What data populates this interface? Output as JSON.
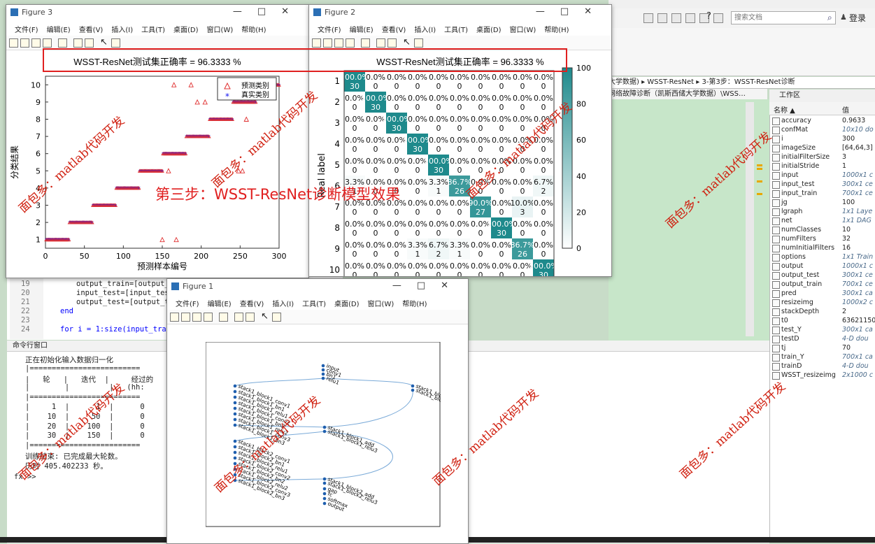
{
  "desktop": {
    "search_placeholder": "搜索文档",
    "login_label": "登录",
    "path_segments": "大学数据) ▸ WSST-ResNet ▸ 3-第3步：WSST-ResNet诊断",
    "path_sub": "网络故障诊断（凯斯西储大学数据）\\WSS…"
  },
  "editor": {
    "line_numbers": [
      "19",
      "20",
      "21",
      "22",
      "23",
      "24"
    ],
    "lines": [
      "output_train=[output_tr",
      "input_test=[input_test;",
      "output_test=[output_tes",
      "end",
      "",
      "for i = 1:size(input_train,"
    ]
  },
  "command_window": {
    "title": "命令行窗口",
    "lines": [
      "正在初始化输入数据归一化",
      "|=========================",
      "|   轮   |   迭代  |     经过的",
      "|        |         |   (hh:",
      "|=========================",
      "|     1  |      1  |      0",
      "|    10  |     50  |      0",
      "|    20  |    100  |      0",
      "|    30  |    150  |      0",
      "|=========================",
      "训练结束: 已完成最大轮数。",
      "历时 405.402233 秒。"
    ],
    "prompt": "fx >>"
  },
  "workspace": {
    "title": "工作区",
    "header_name": "名称 ▲",
    "header_value": "值",
    "vars": [
      {
        "name": "accuracy",
        "value": "0.9633",
        "italic": false
      },
      {
        "name": "confMat",
        "value": "10x10 do",
        "italic": true
      },
      {
        "name": "i",
        "value": "300",
        "italic": false
      },
      {
        "name": "imageSize",
        "value": "[64,64,3]",
        "italic": false
      },
      {
        "name": "initialFilterSize",
        "value": "3",
        "italic": false
      },
      {
        "name": "initialStride",
        "value": "1",
        "italic": false
      },
      {
        "name": "input",
        "value": "1000x1 c",
        "italic": true
      },
      {
        "name": "input_test",
        "value": "300x1 ce",
        "italic": true
      },
      {
        "name": "input_train",
        "value": "700x1 ce",
        "italic": true
      },
      {
        "name": "jg",
        "value": "100",
        "italic": false
      },
      {
        "name": "lgraph",
        "value": "1x1 Laye",
        "italic": true
      },
      {
        "name": "net",
        "value": "1x1 DAG",
        "italic": true
      },
      {
        "name": "numClasses",
        "value": "10",
        "italic": false
      },
      {
        "name": "numFilters",
        "value": "32",
        "italic": false
      },
      {
        "name": "numInitialFilters",
        "value": "16",
        "italic": false
      },
      {
        "name": "options",
        "value": "1x1 Train",
        "italic": true
      },
      {
        "name": "output",
        "value": "1000x1 c",
        "italic": true
      },
      {
        "name": "output_test",
        "value": "300x1 ce",
        "italic": true
      },
      {
        "name": "output_train",
        "value": "700x1 ce",
        "italic": true
      },
      {
        "name": "pred",
        "value": "300x1 ca",
        "italic": true
      },
      {
        "name": "resizeimg",
        "value": "1000x2 c",
        "italic": true
      },
      {
        "name": "stackDepth",
        "value": "2",
        "italic": false
      },
      {
        "name": "t0",
        "value": "63621150",
        "italic": false
      },
      {
        "name": "test_Y",
        "value": "300x1 ca",
        "italic": true
      },
      {
        "name": "testD",
        "value": "4-D dou",
        "italic": true
      },
      {
        "name": "tj",
        "value": "70",
        "italic": false
      },
      {
        "name": "train_Y",
        "value": "700x1 ca",
        "italic": true
      },
      {
        "name": "trainD",
        "value": "4-D dou",
        "italic": true
      },
      {
        "name": "WSST_resizeimg",
        "value": "2x1000 c",
        "italic": true
      }
    ]
  },
  "menus": [
    "文件(F)",
    "编辑(E)",
    "查看(V)",
    "插入(I)",
    "工具(T)",
    "桌面(D)",
    "窗口(W)",
    "帮助(H)"
  ],
  "figure3": {
    "title": "Figure 3",
    "chart_data": {
      "type": "scatter",
      "title": "WSST-ResNet测试集正确率 = 96.3333 %",
      "xlabel": "预测样本编号",
      "ylabel": "分类结果",
      "xlim": [
        0,
        300
      ],
      "ylim": [
        0.5,
        10.5
      ],
      "xticks": [
        "0",
        "50",
        "100",
        "150",
        "200",
        "250",
        "300"
      ],
      "yticks": [
        "1",
        "2",
        "3",
        "4",
        "5",
        "6",
        "7",
        "8",
        "9",
        "10"
      ],
      "legend": [
        "预测类别",
        "真实类别"
      ],
      "legend_position": "top-right",
      "true_segments": [
        {
          "class": 1,
          "from": 1,
          "to": 30
        },
        {
          "class": 2,
          "from": 31,
          "to": 60
        },
        {
          "class": 3,
          "from": 61,
          "to": 90
        },
        {
          "class": 4,
          "from": 91,
          "to": 120
        },
        {
          "class": 5,
          "from": 121,
          "to": 150
        },
        {
          "class": 6,
          "from": 151,
          "to": 180
        },
        {
          "class": 7,
          "from": 181,
          "to": 210
        },
        {
          "class": 8,
          "from": 211,
          "to": 240
        },
        {
          "class": 9,
          "from": 241,
          "to": 270
        },
        {
          "class": 10,
          "from": 271,
          "to": 300
        }
      ],
      "mispredictions": [
        {
          "x": 150,
          "y": 1
        },
        {
          "x": 158,
          "y": 5
        },
        {
          "x": 165,
          "y": 10
        },
        {
          "x": 168,
          "y": 1
        },
        {
          "x": 187,
          "y": 10
        },
        {
          "x": 195,
          "y": 9
        },
        {
          "x": 205,
          "y": 9
        },
        {
          "x": 248,
          "y": 5
        },
        {
          "x": 253,
          "y": 5
        },
        {
          "x": 258,
          "y": 8
        },
        {
          "x": 263,
          "y": 10
        }
      ]
    }
  },
  "figure2": {
    "title": "Figure 2",
    "chart_data": {
      "type": "heatmap",
      "title": "WSST-ResNet测试集正确率 = 96.3333 %",
      "xlabel": "Predicted label",
      "ylabel": "Real label",
      "labels": [
        "1",
        "2",
        "3",
        "4",
        "5",
        "6",
        "7",
        "8",
        "9",
        "10"
      ],
      "colorbar_ticks": [
        "0",
        "20",
        "40",
        "60",
        "80",
        "100"
      ],
      "counts": [
        [
          30,
          0,
          0,
          0,
          0,
          0,
          0,
          0,
          0,
          0
        ],
        [
          0,
          30,
          0,
          0,
          0,
          0,
          0,
          0,
          0,
          0
        ],
        [
          0,
          0,
          30,
          0,
          0,
          0,
          0,
          0,
          0,
          0
        ],
        [
          0,
          0,
          0,
          30,
          0,
          0,
          0,
          0,
          0,
          0
        ],
        [
          0,
          0,
          0,
          0,
          30,
          0,
          0,
          0,
          0,
          0
        ],
        [
          1,
          0,
          0,
          0,
          1,
          26,
          0,
          0,
          0,
          2
        ],
        [
          0,
          0,
          0,
          0,
          0,
          0,
          27,
          0,
          3,
          0
        ],
        [
          0,
          0,
          0,
          0,
          0,
          0,
          0,
          30,
          0,
          0
        ],
        [
          0,
          0,
          0,
          1,
          2,
          1,
          0,
          0,
          26,
          0
        ],
        [
          0,
          0,
          0,
          0,
          0,
          0,
          0,
          0,
          0,
          30
        ]
      ],
      "percents": [
        [
          "100.0%",
          "0.0%",
          "0.0%",
          "0.0%",
          "0.0%",
          "0.0%",
          "0.0%",
          "0.0%",
          "0.0%",
          "0.0%"
        ],
        [
          "0.0%",
          "100.0%",
          "0.0%",
          "0.0%",
          "0.0%",
          "0.0%",
          "0.0%",
          "0.0%",
          "0.0%",
          "0.0%"
        ],
        [
          "0.0%",
          "0.0%",
          "100.0%",
          "0.0%",
          "0.0%",
          "0.0%",
          "0.0%",
          "0.0%",
          "0.0%",
          "0.0%"
        ],
        [
          "0.0%",
          "0.0%",
          "0.0%",
          "100.0%",
          "0.0%",
          "0.0%",
          "0.0%",
          "0.0%",
          "0.0%",
          "0.0%"
        ],
        [
          "0.0%",
          "0.0%",
          "0.0%",
          "0.0%",
          "100.0%",
          "0.0%",
          "0.0%",
          "0.0%",
          "0.0%",
          "0.0%"
        ],
        [
          "3.3%",
          "0.0%",
          "0.0%",
          "0.0%",
          "3.3%",
          "86.7%",
          "0.0%",
          "0.0%",
          "0.0%",
          "6.7%"
        ],
        [
          "0.0%",
          "0.0%",
          "0.0%",
          "0.0%",
          "0.0%",
          "0.0%",
          "90.0%",
          "0.0%",
          "10.0%",
          "0.0%"
        ],
        [
          "0.0%",
          "0.0%",
          "0.0%",
          "0.0%",
          "0.0%",
          "0.0%",
          "0.0%",
          "100.0%",
          "0.0%",
          "0.0%"
        ],
        [
          "0.0%",
          "0.0%",
          "0.0%",
          "3.3%",
          "6.7%",
          "3.3%",
          "0.0%",
          "0.0%",
          "86.7%",
          "0.0%"
        ],
        [
          "0.0%",
          "0.0%",
          "0.0%",
          "0.0%",
          "0.0%",
          "0.0%",
          "0.0%",
          "0.0%",
          "0.0%",
          "100.0%"
        ]
      ],
      "colormap": [
        "#ffffff",
        "#1e8a8c"
      ]
    }
  },
  "figure1": {
    "title": "Figure 1",
    "graph_nodes": [
      "input",
      "conv1",
      "bn1",
      "relu1",
      "stack1_block1_conv1",
      "stack1_block1_bn1",
      "stack1_block1_relu1",
      "stack1_block1_conv2",
      "stack1_block1_bn2",
      "stack1_block1_relu2",
      "stack1_block1_conv3",
      "stack1_block1_bn3",
      "stack1_block1_skip_conv",
      "stack1_block1_skip_bn",
      "stack1_block1_add",
      "stack1_block1_relu3",
      "stack1_block2_conv1",
      "stack1_block2_bn1",
      "stack1_block2_relu1",
      "stack1_block2_conv2",
      "stack1_block2_bn2",
      "stack1_block2_relu2",
      "stack1_block2_conv3",
      "stack1_block2_bn3",
      "stack1_block2_add",
      "stack1_block2_relu3",
      "gap",
      "fc",
      "softmax",
      "output"
    ]
  },
  "overlay": {
    "step_caption": "第三步：WSST-ResNet诊断模型效果",
    "watermark": "面包多：matlab代码开发"
  }
}
